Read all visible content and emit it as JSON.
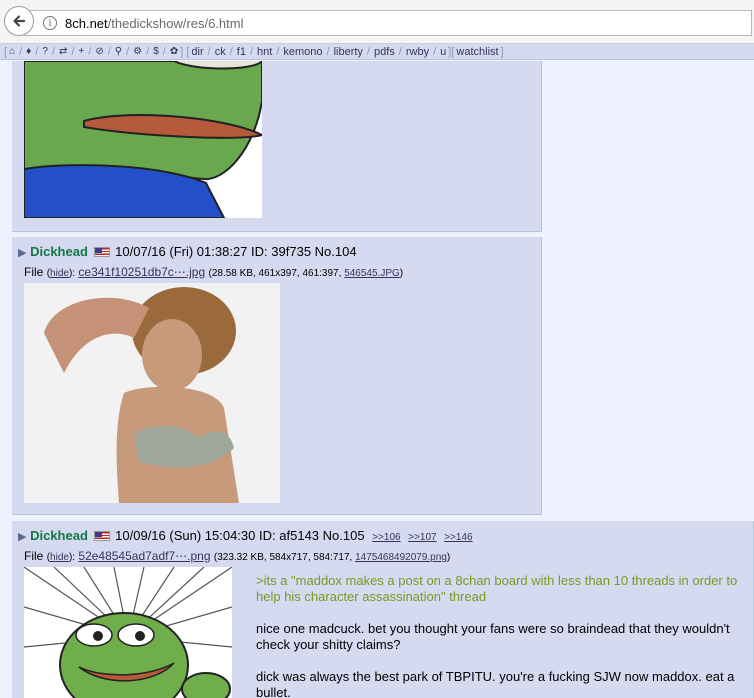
{
  "browser": {
    "url_host": "8ch.net",
    "url_path": "/thedickshow/res/6.html"
  },
  "boardlist": {
    "icons": [
      "home-icon",
      "tags-icon",
      "help-icon",
      "random-icon",
      "add-icon",
      "ban-icon",
      "search-icon",
      "gear-icon",
      "dollar-icon",
      "twitter-icon"
    ],
    "boards": [
      "dir",
      "ck",
      "f1",
      "hnt",
      "kemono",
      "liberty",
      "pdfs",
      "rwby",
      "u"
    ],
    "watchlist": "watchlist"
  },
  "posts": [
    {
      "name": "Dickhead",
      "datetime": "10/07/16 (Fri) 01:38:27",
      "id_label": "ID:",
      "id": "39f735",
      "no": "No.104",
      "file_label": "File",
      "hide": "hide",
      "filename": "ce341f10251db7c⋯.jpg",
      "fileinfo_prefix": "(28.58 KB, 461x397, 461:397, ",
      "orig_name": "546545.JPG",
      "fileinfo_suffix": ")"
    },
    {
      "name": "Dickhead",
      "datetime": "10/09/16 (Sun) 15:04:30",
      "id_label": "ID:",
      "id": "af5143",
      "no": "No.105",
      "backlinks": [
        ">>106",
        ">>107",
        ">>146"
      ],
      "file_label": "File",
      "hide": "hide",
      "filename": "52e48545ad7adf7⋯.png",
      "fileinfo_prefix": "(323.32 KB, 584x717, 584:717, ",
      "orig_name": "1475468492079.png",
      "fileinfo_suffix": ")",
      "greentext": ">its a \"maddox makes a post on a 8chan board with less than 10 threads in order to help his character assassination\" thread",
      "para1": "nice one madcuck. bet you thought your fans were so braindead that they wouldn't check your shitty claims?",
      "para2": "dick was always the best park of TBPITU. you're a fucking SJW now maddox. eat a bullet."
    }
  ],
  "colors": {
    "post_bg": "#d6daf0",
    "page_bg": "#eef2ff",
    "name": "#117743",
    "link": "#34345c",
    "greentext": "#789922"
  }
}
